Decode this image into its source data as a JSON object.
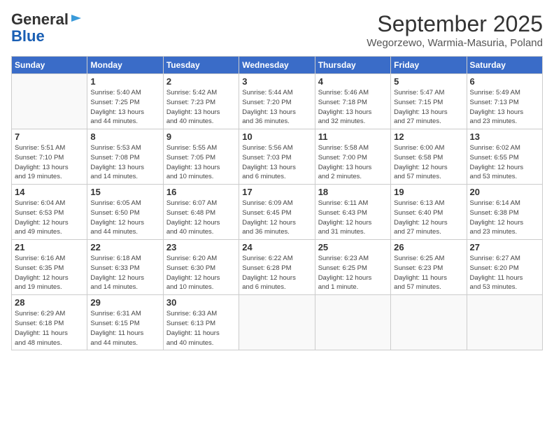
{
  "logo": {
    "line1": "General",
    "line2": "Blue"
  },
  "title": "September 2025",
  "subtitle": "Wegorzewo, Warmia-Masuria, Poland",
  "days_header": [
    "Sunday",
    "Monday",
    "Tuesday",
    "Wednesday",
    "Thursday",
    "Friday",
    "Saturday"
  ],
  "weeks": [
    [
      {
        "day": "",
        "info": ""
      },
      {
        "day": "1",
        "info": "Sunrise: 5:40 AM\nSunset: 7:25 PM\nDaylight: 13 hours\nand 44 minutes."
      },
      {
        "day": "2",
        "info": "Sunrise: 5:42 AM\nSunset: 7:23 PM\nDaylight: 13 hours\nand 40 minutes."
      },
      {
        "day": "3",
        "info": "Sunrise: 5:44 AM\nSunset: 7:20 PM\nDaylight: 13 hours\nand 36 minutes."
      },
      {
        "day": "4",
        "info": "Sunrise: 5:46 AM\nSunset: 7:18 PM\nDaylight: 13 hours\nand 32 minutes."
      },
      {
        "day": "5",
        "info": "Sunrise: 5:47 AM\nSunset: 7:15 PM\nDaylight: 13 hours\nand 27 minutes."
      },
      {
        "day": "6",
        "info": "Sunrise: 5:49 AM\nSunset: 7:13 PM\nDaylight: 13 hours\nand 23 minutes."
      }
    ],
    [
      {
        "day": "7",
        "info": "Sunrise: 5:51 AM\nSunset: 7:10 PM\nDaylight: 13 hours\nand 19 minutes."
      },
      {
        "day": "8",
        "info": "Sunrise: 5:53 AM\nSunset: 7:08 PM\nDaylight: 13 hours\nand 14 minutes."
      },
      {
        "day": "9",
        "info": "Sunrise: 5:55 AM\nSunset: 7:05 PM\nDaylight: 13 hours\nand 10 minutes."
      },
      {
        "day": "10",
        "info": "Sunrise: 5:56 AM\nSunset: 7:03 PM\nDaylight: 13 hours\nand 6 minutes."
      },
      {
        "day": "11",
        "info": "Sunrise: 5:58 AM\nSunset: 7:00 PM\nDaylight: 13 hours\nand 2 minutes."
      },
      {
        "day": "12",
        "info": "Sunrise: 6:00 AM\nSunset: 6:58 PM\nDaylight: 12 hours\nand 57 minutes."
      },
      {
        "day": "13",
        "info": "Sunrise: 6:02 AM\nSunset: 6:55 PM\nDaylight: 12 hours\nand 53 minutes."
      }
    ],
    [
      {
        "day": "14",
        "info": "Sunrise: 6:04 AM\nSunset: 6:53 PM\nDaylight: 12 hours\nand 49 minutes."
      },
      {
        "day": "15",
        "info": "Sunrise: 6:05 AM\nSunset: 6:50 PM\nDaylight: 12 hours\nand 44 minutes."
      },
      {
        "day": "16",
        "info": "Sunrise: 6:07 AM\nSunset: 6:48 PM\nDaylight: 12 hours\nand 40 minutes."
      },
      {
        "day": "17",
        "info": "Sunrise: 6:09 AM\nSunset: 6:45 PM\nDaylight: 12 hours\nand 36 minutes."
      },
      {
        "day": "18",
        "info": "Sunrise: 6:11 AM\nSunset: 6:43 PM\nDaylight: 12 hours\nand 31 minutes."
      },
      {
        "day": "19",
        "info": "Sunrise: 6:13 AM\nSunset: 6:40 PM\nDaylight: 12 hours\nand 27 minutes."
      },
      {
        "day": "20",
        "info": "Sunrise: 6:14 AM\nSunset: 6:38 PM\nDaylight: 12 hours\nand 23 minutes."
      }
    ],
    [
      {
        "day": "21",
        "info": "Sunrise: 6:16 AM\nSunset: 6:35 PM\nDaylight: 12 hours\nand 19 minutes."
      },
      {
        "day": "22",
        "info": "Sunrise: 6:18 AM\nSunset: 6:33 PM\nDaylight: 12 hours\nand 14 minutes."
      },
      {
        "day": "23",
        "info": "Sunrise: 6:20 AM\nSunset: 6:30 PM\nDaylight: 12 hours\nand 10 minutes."
      },
      {
        "day": "24",
        "info": "Sunrise: 6:22 AM\nSunset: 6:28 PM\nDaylight: 12 hours\nand 6 minutes."
      },
      {
        "day": "25",
        "info": "Sunrise: 6:23 AM\nSunset: 6:25 PM\nDaylight: 12 hours\nand 1 minute."
      },
      {
        "day": "26",
        "info": "Sunrise: 6:25 AM\nSunset: 6:23 PM\nDaylight: 11 hours\nand 57 minutes."
      },
      {
        "day": "27",
        "info": "Sunrise: 6:27 AM\nSunset: 6:20 PM\nDaylight: 11 hours\nand 53 minutes."
      }
    ],
    [
      {
        "day": "28",
        "info": "Sunrise: 6:29 AM\nSunset: 6:18 PM\nDaylight: 11 hours\nand 48 minutes."
      },
      {
        "day": "29",
        "info": "Sunrise: 6:31 AM\nSunset: 6:15 PM\nDaylight: 11 hours\nand 44 minutes."
      },
      {
        "day": "30",
        "info": "Sunrise: 6:33 AM\nSunset: 6:13 PM\nDaylight: 11 hours\nand 40 minutes."
      },
      {
        "day": "",
        "info": ""
      },
      {
        "day": "",
        "info": ""
      },
      {
        "day": "",
        "info": ""
      },
      {
        "day": "",
        "info": ""
      }
    ]
  ]
}
